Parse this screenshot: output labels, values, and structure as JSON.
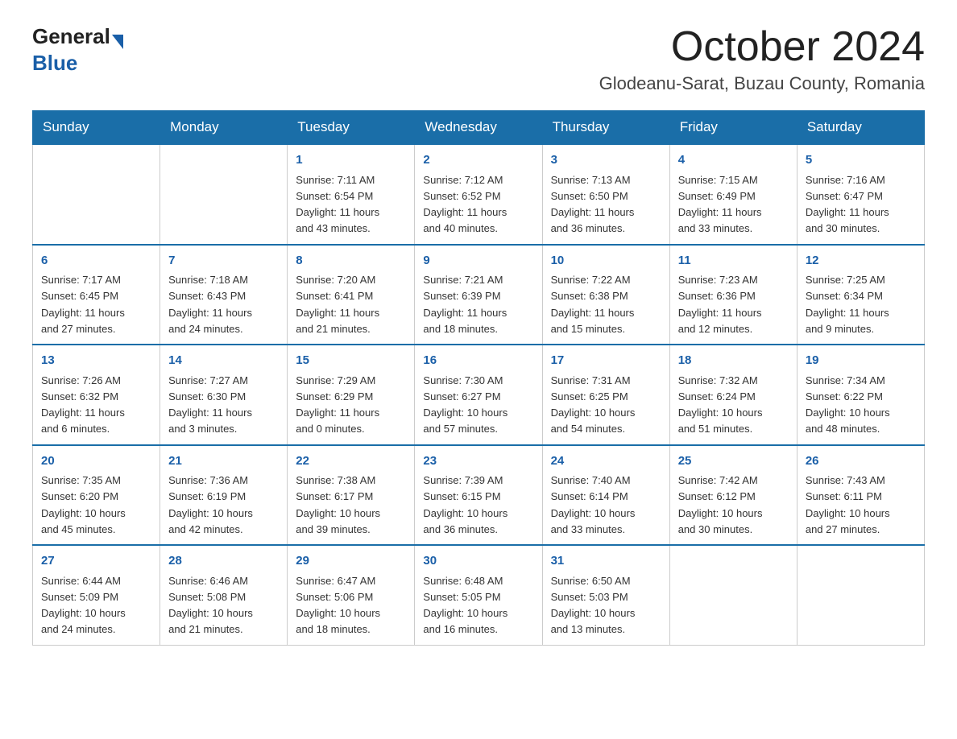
{
  "logo": {
    "general": "General",
    "blue": "Blue",
    "arrow": "▶"
  },
  "title": "October 2024",
  "subtitle": "Glodeanu-Sarat, Buzau County, Romania",
  "days_of_week": [
    "Sunday",
    "Monday",
    "Tuesday",
    "Wednesday",
    "Thursday",
    "Friday",
    "Saturday"
  ],
  "weeks": [
    [
      {
        "day": "",
        "info": ""
      },
      {
        "day": "",
        "info": ""
      },
      {
        "day": "1",
        "info": "Sunrise: 7:11 AM\nSunset: 6:54 PM\nDaylight: 11 hours\nand 43 minutes."
      },
      {
        "day": "2",
        "info": "Sunrise: 7:12 AM\nSunset: 6:52 PM\nDaylight: 11 hours\nand 40 minutes."
      },
      {
        "day": "3",
        "info": "Sunrise: 7:13 AM\nSunset: 6:50 PM\nDaylight: 11 hours\nand 36 minutes."
      },
      {
        "day": "4",
        "info": "Sunrise: 7:15 AM\nSunset: 6:49 PM\nDaylight: 11 hours\nand 33 minutes."
      },
      {
        "day": "5",
        "info": "Sunrise: 7:16 AM\nSunset: 6:47 PM\nDaylight: 11 hours\nand 30 minutes."
      }
    ],
    [
      {
        "day": "6",
        "info": "Sunrise: 7:17 AM\nSunset: 6:45 PM\nDaylight: 11 hours\nand 27 minutes."
      },
      {
        "day": "7",
        "info": "Sunrise: 7:18 AM\nSunset: 6:43 PM\nDaylight: 11 hours\nand 24 minutes."
      },
      {
        "day": "8",
        "info": "Sunrise: 7:20 AM\nSunset: 6:41 PM\nDaylight: 11 hours\nand 21 minutes."
      },
      {
        "day": "9",
        "info": "Sunrise: 7:21 AM\nSunset: 6:39 PM\nDaylight: 11 hours\nand 18 minutes."
      },
      {
        "day": "10",
        "info": "Sunrise: 7:22 AM\nSunset: 6:38 PM\nDaylight: 11 hours\nand 15 minutes."
      },
      {
        "day": "11",
        "info": "Sunrise: 7:23 AM\nSunset: 6:36 PM\nDaylight: 11 hours\nand 12 minutes."
      },
      {
        "day": "12",
        "info": "Sunrise: 7:25 AM\nSunset: 6:34 PM\nDaylight: 11 hours\nand 9 minutes."
      }
    ],
    [
      {
        "day": "13",
        "info": "Sunrise: 7:26 AM\nSunset: 6:32 PM\nDaylight: 11 hours\nand 6 minutes."
      },
      {
        "day": "14",
        "info": "Sunrise: 7:27 AM\nSunset: 6:30 PM\nDaylight: 11 hours\nand 3 minutes."
      },
      {
        "day": "15",
        "info": "Sunrise: 7:29 AM\nSunset: 6:29 PM\nDaylight: 11 hours\nand 0 minutes."
      },
      {
        "day": "16",
        "info": "Sunrise: 7:30 AM\nSunset: 6:27 PM\nDaylight: 10 hours\nand 57 minutes."
      },
      {
        "day": "17",
        "info": "Sunrise: 7:31 AM\nSunset: 6:25 PM\nDaylight: 10 hours\nand 54 minutes."
      },
      {
        "day": "18",
        "info": "Sunrise: 7:32 AM\nSunset: 6:24 PM\nDaylight: 10 hours\nand 51 minutes."
      },
      {
        "day": "19",
        "info": "Sunrise: 7:34 AM\nSunset: 6:22 PM\nDaylight: 10 hours\nand 48 minutes."
      }
    ],
    [
      {
        "day": "20",
        "info": "Sunrise: 7:35 AM\nSunset: 6:20 PM\nDaylight: 10 hours\nand 45 minutes."
      },
      {
        "day": "21",
        "info": "Sunrise: 7:36 AM\nSunset: 6:19 PM\nDaylight: 10 hours\nand 42 minutes."
      },
      {
        "day": "22",
        "info": "Sunrise: 7:38 AM\nSunset: 6:17 PM\nDaylight: 10 hours\nand 39 minutes."
      },
      {
        "day": "23",
        "info": "Sunrise: 7:39 AM\nSunset: 6:15 PM\nDaylight: 10 hours\nand 36 minutes."
      },
      {
        "day": "24",
        "info": "Sunrise: 7:40 AM\nSunset: 6:14 PM\nDaylight: 10 hours\nand 33 minutes."
      },
      {
        "day": "25",
        "info": "Sunrise: 7:42 AM\nSunset: 6:12 PM\nDaylight: 10 hours\nand 30 minutes."
      },
      {
        "day": "26",
        "info": "Sunrise: 7:43 AM\nSunset: 6:11 PM\nDaylight: 10 hours\nand 27 minutes."
      }
    ],
    [
      {
        "day": "27",
        "info": "Sunrise: 6:44 AM\nSunset: 5:09 PM\nDaylight: 10 hours\nand 24 minutes."
      },
      {
        "day": "28",
        "info": "Sunrise: 6:46 AM\nSunset: 5:08 PM\nDaylight: 10 hours\nand 21 minutes."
      },
      {
        "day": "29",
        "info": "Sunrise: 6:47 AM\nSunset: 5:06 PM\nDaylight: 10 hours\nand 18 minutes."
      },
      {
        "day": "30",
        "info": "Sunrise: 6:48 AM\nSunset: 5:05 PM\nDaylight: 10 hours\nand 16 minutes."
      },
      {
        "day": "31",
        "info": "Sunrise: 6:50 AM\nSunset: 5:03 PM\nDaylight: 10 hours\nand 13 minutes."
      },
      {
        "day": "",
        "info": ""
      },
      {
        "day": "",
        "info": ""
      }
    ]
  ]
}
